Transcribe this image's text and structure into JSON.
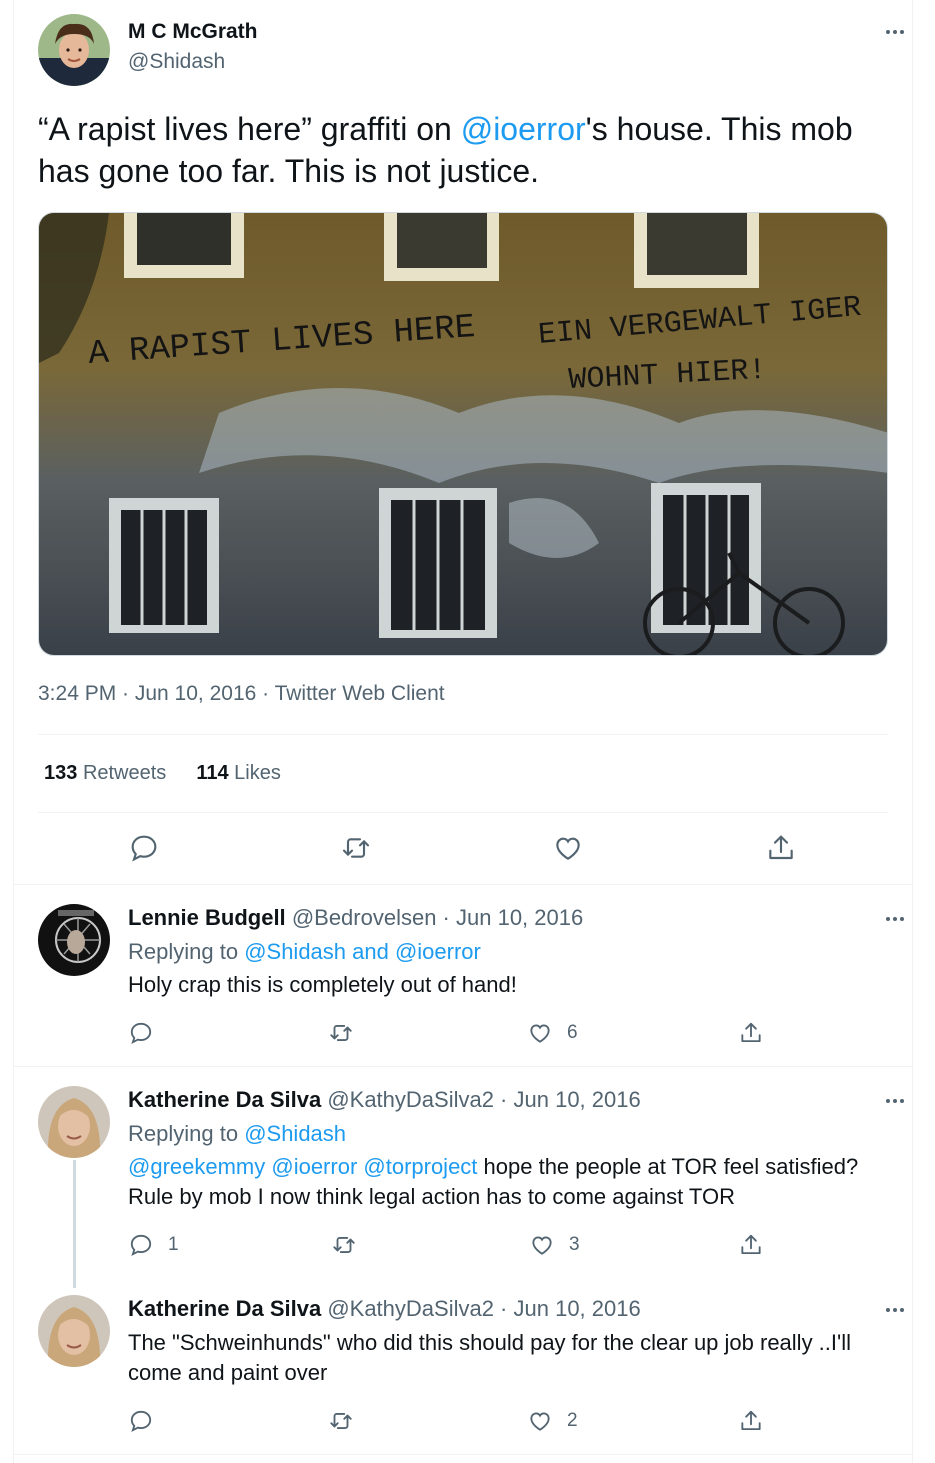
{
  "main": {
    "name": "M C McGrath",
    "handle": "@Shidash",
    "text_a": "“A rapist lives here” graffiti on ",
    "mention": "@ioerror",
    "text_b": "'s house. This mob has gone too far. This is not justice.",
    "photo": {
      "graffiti_en": "A RAPIST LIVES HERE",
      "graffiti_de_1": "EIN VERGEWALT IGER",
      "graffiti_de_2": "WOHNT HIER!"
    },
    "meta": "3:24 PM · Jun 10, 2016 · Twitter Web Client",
    "retweets_count": "133",
    "retweets_label": "Retweets",
    "likes_count": "114",
    "likes_label": "Likes"
  },
  "replies": [
    {
      "name": "Lennie Budgell",
      "handle_date": "@Bedrovelsen · Jun 10, 2016",
      "replying_prefix": "Replying to ",
      "replying_to": "@Shidash and @ioerror",
      "text": "Holy crap this is completely out of hand!",
      "reply_count": "",
      "like_count": "6"
    },
    {
      "name": "Katherine Da Silva",
      "handle_date": "@KathyDaSilva2 · Jun 10, 2016",
      "replying_prefix": "Replying to ",
      "replying_to": "@Shidash",
      "mentions": "@greekemmy @ioerror @torproject",
      "text": " hope the people at TOR feel satisfied?Rule by mob I now think legal action has to come against TOR",
      "reply_count": "1",
      "like_count": "3"
    },
    {
      "name": "Katherine Da Silva",
      "handle_date": "@KathyDaSilva2 · Jun 10, 2016",
      "text": "The \"Schweinhunds\" who did this should pay for the clear up job really ..I'll come and paint over",
      "like_count": "2"
    }
  ],
  "icons": [
    "reply-icon",
    "retweet-icon",
    "like-icon",
    "share-icon",
    "more-icon"
  ]
}
